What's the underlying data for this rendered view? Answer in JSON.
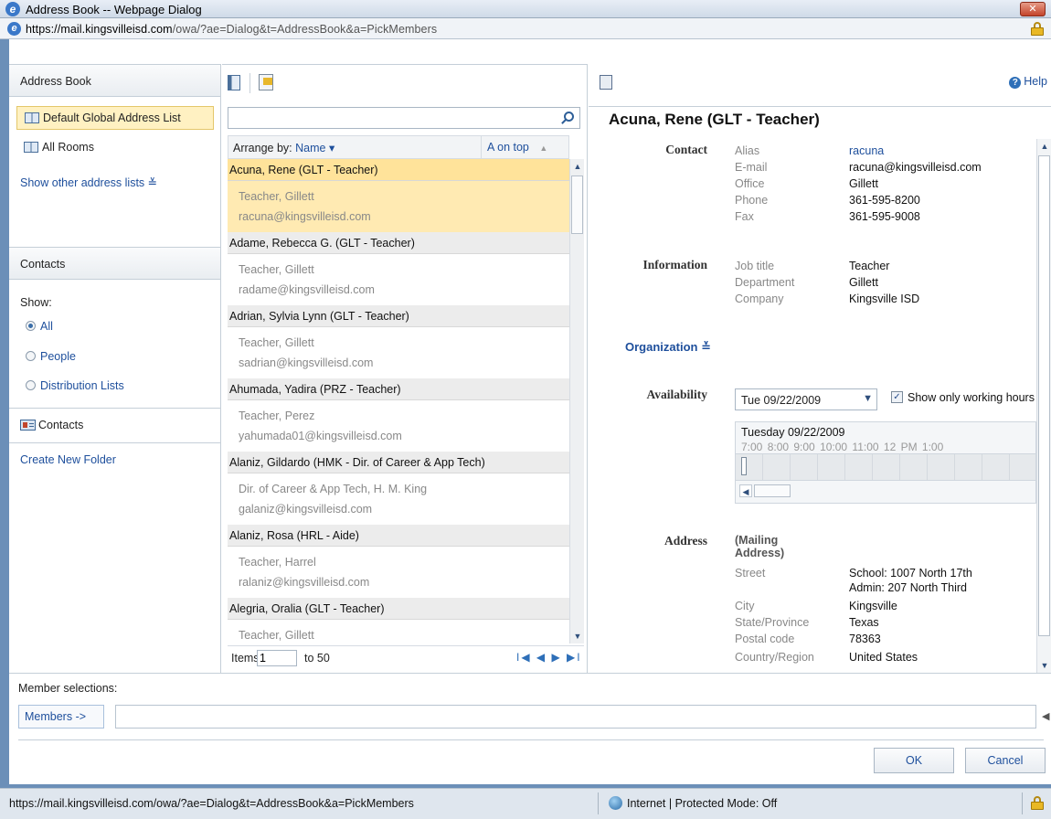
{
  "window": {
    "title": "Address Book -- Webpage Dialog",
    "close_label": "✕",
    "url_host": "https://mail.kingsvilleisd.com",
    "url_path": "/owa/?ae=Dialog&t=AddressBook&a=PickMembers"
  },
  "leftnav": {
    "header": "Address Book",
    "lists": [
      {
        "label": "Default Global Address List",
        "selected": true
      },
      {
        "label": "All Rooms",
        "selected": false
      }
    ],
    "show_other": "Show other address lists",
    "contacts_header": "Contacts",
    "show_label": "Show:",
    "filters": [
      {
        "label": "All",
        "checked": true
      },
      {
        "label": "People",
        "checked": false
      },
      {
        "label": "Distribution Lists",
        "checked": false
      }
    ],
    "contacts_folder": "Contacts",
    "create_folder": "Create New Folder"
  },
  "list": {
    "search_placeholder": "",
    "arrange_prefix": "Arrange by:",
    "arrange_field": "Name",
    "sort_order": "A on top",
    "entries": [
      {
        "name": "Acuna, Rene (GLT - Teacher)",
        "line1": "Teacher, Gillett",
        "line2": "racuna@kingsvilleisd.com",
        "selected": true
      },
      {
        "name": "Adame, Rebecca G. (GLT - Teacher)",
        "line1": "Teacher, Gillett",
        "line2": "radame@kingsvilleisd.com",
        "selected": false
      },
      {
        "name": "Adrian, Sylvia Lynn (GLT - Teacher)",
        "line1": "Teacher, Gillett",
        "line2": "sadrian@kingsvilleisd.com",
        "selected": false
      },
      {
        "name": "Ahumada, Yadira (PRZ - Teacher)",
        "line1": "Teacher, Perez",
        "line2": "yahumada01@kingsvilleisd.com",
        "selected": false
      },
      {
        "name": "Alaniz, Gildardo (HMK - Dir. of Career & App Tech)",
        "line1": "Dir. of Career & App Tech, H. M. King",
        "line2": "galaniz@kingsvilleisd.com",
        "selected": false
      },
      {
        "name": "Alaniz, Rosa (HRL - Aide)",
        "line1": "Teacher, Harrel",
        "line2": "ralaniz@kingsvilleisd.com",
        "selected": false
      },
      {
        "name": "Alegria, Oralia (GLT - Teacher)",
        "line1": "Teacher, Gillett",
        "line2": "",
        "selected": false
      }
    ],
    "pager": {
      "items_label": "Items",
      "from": "1",
      "to_label": "to 50",
      "nav": "I◀ ◀ ▶ ▶I"
    }
  },
  "detail": {
    "help": "Help",
    "name": "Acuna, Rene (GLT - Teacher)",
    "contact": {
      "section": "Contact",
      "rows": [
        {
          "label": "Alias",
          "value": "racuna"
        },
        {
          "label": "E-mail",
          "value": "racuna@kingsvilleisd.com"
        },
        {
          "label": "Office",
          "value": "Gillett"
        },
        {
          "label": "Phone",
          "value": "361-595-8200"
        },
        {
          "label": "Fax",
          "value": "361-595-9008"
        }
      ]
    },
    "information": {
      "section": "Information",
      "rows": [
        {
          "label": "Job title",
          "value": "Teacher"
        },
        {
          "label": "Department",
          "value": "Gillett"
        },
        {
          "label": "Company",
          "value": "Kingsville ISD"
        }
      ]
    },
    "organization": "Organization",
    "availability": {
      "section": "Availability",
      "date": "Tue 09/22/2009",
      "working_hours": "Show only working hours",
      "day_label": "Tuesday 09/22/2009",
      "hours": "7:00 8:00 9:00 10:00 11:00 12 PM 1:00"
    },
    "address": {
      "section": "Address",
      "mailing_label": "(Mailing Address)",
      "rows": [
        {
          "label": "Street",
          "value": "School: 1007 North 17th"
        },
        {
          "label": "",
          "value": "Admin: 207 North Third"
        },
        {
          "label": "City",
          "value": "Kingsville"
        },
        {
          "label": "State/Province",
          "value": "Texas"
        },
        {
          "label": "Postal code",
          "value": "78363"
        },
        {
          "label": "Country/Region",
          "value": "United States"
        }
      ]
    }
  },
  "members": {
    "label": "Member selections:",
    "button": "Members ->",
    "value": "",
    "ok": "OK",
    "cancel": "Cancel"
  },
  "status": {
    "url": "https://mail.kingsvilleisd.com/owa/?ae=Dialog&t=AddressBook&a=PickMembers",
    "zone": "Internet | Protected Mode: Off"
  },
  "colors": {
    "accent_link": "#1e4f9c",
    "selection": "#ffeab2",
    "window_frame": "#6b8fb8"
  }
}
